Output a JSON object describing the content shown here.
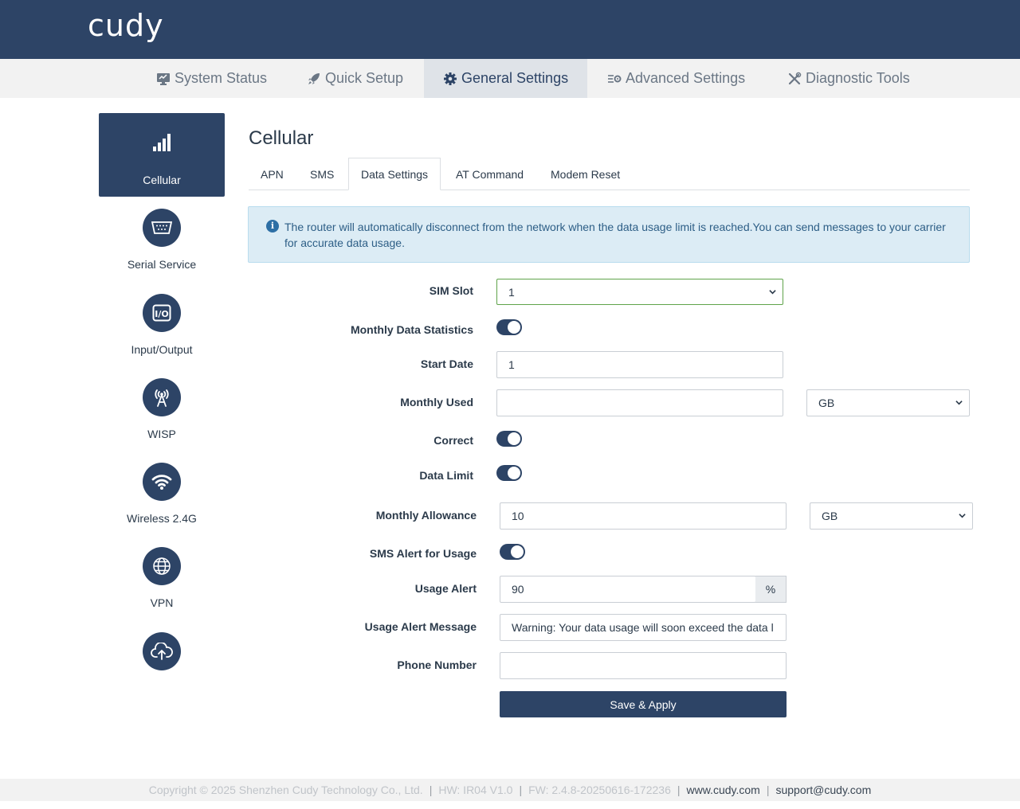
{
  "brand": {
    "logo_text": "cudy"
  },
  "colors": {
    "primary": "#2d4466",
    "info_bg": "#dcecf5",
    "info_text": "#2d5e86",
    "select_focus": "#5fa34a"
  },
  "main_nav": [
    {
      "label": "System Status",
      "icon": "monitor-icon"
    },
    {
      "label": "Quick Setup",
      "icon": "rocket-icon"
    },
    {
      "label": "General Settings",
      "icon": "gear-icon",
      "active": true
    },
    {
      "label": "Advanced Settings",
      "icon": "sliders-icon"
    },
    {
      "label": "Diagnostic Tools",
      "icon": "tools-icon"
    }
  ],
  "sidebar": {
    "items": [
      {
        "label": "Cellular",
        "icon": "signal-bars-icon",
        "active": true
      },
      {
        "label": "Serial Service",
        "icon": "serial-port-icon"
      },
      {
        "label": "Input/Output",
        "icon": "io-icon"
      },
      {
        "label": "WISP",
        "icon": "antenna-icon"
      },
      {
        "label": "Wireless 2.4G",
        "icon": "wifi-icon"
      },
      {
        "label": "VPN",
        "icon": "globe-icon"
      },
      {
        "label": "",
        "icon": "cloud-upload-icon"
      }
    ]
  },
  "page": {
    "title": "Cellular",
    "tabs": [
      {
        "label": "APN"
      },
      {
        "label": "SMS"
      },
      {
        "label": "Data Settings",
        "active": true
      },
      {
        "label": "AT Command"
      },
      {
        "label": "Modem Reset"
      }
    ],
    "info": "The router will automatically disconnect from the network when the data usage limit is reached.You can send messages to your carrier for accurate data usage."
  },
  "form": {
    "sim_slot": {
      "label": "SIM Slot",
      "value": "1"
    },
    "monthly_stats": {
      "label": "Monthly Data Statistics",
      "enabled": true
    },
    "start_date": {
      "label": "Start Date",
      "value": "1"
    },
    "monthly_used": {
      "label": "Monthly Used",
      "value": "",
      "unit": "GB"
    },
    "correct": {
      "label": "Correct",
      "enabled": true
    },
    "data_limit": {
      "label": "Data Limit",
      "enabled": true
    },
    "monthly_allowance": {
      "label": "Monthly Allowance",
      "value": "10",
      "unit": "GB"
    },
    "sms_alert": {
      "label": "SMS Alert for Usage",
      "enabled": true
    },
    "usage_alert": {
      "label": "Usage Alert",
      "value": "90",
      "suffix": "%"
    },
    "alert_message": {
      "label": "Usage Alert Message",
      "value": "Warning: Your data usage will soon exceed the data l"
    },
    "phone_number": {
      "label": "Phone Number",
      "value": ""
    },
    "save_label": "Save & Apply"
  },
  "footer": {
    "copyright": "Copyright © 2025 Shenzhen Cudy Technology Co., Ltd.",
    "hw": "HW: IR04 V1.0",
    "fw": "FW: 2.4.8-20250616-172236",
    "website": "www.cudy.com",
    "email": "support@cudy.com"
  }
}
